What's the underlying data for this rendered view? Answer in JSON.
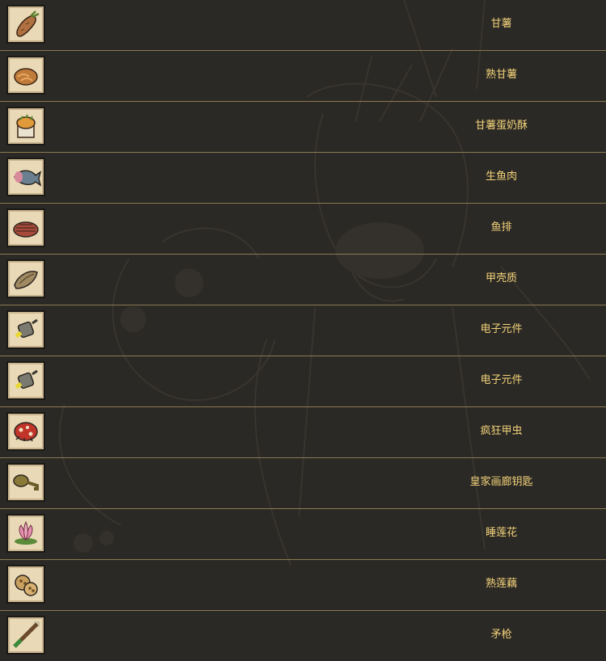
{
  "items": [
    {
      "name": "甘薯",
      "icon": "sweet-potato-icon"
    },
    {
      "name": "熟甘薯",
      "icon": "cooked-sweet-potato-icon"
    },
    {
      "name": "甘薯蛋奶酥",
      "icon": "sweet-potato-souffle-icon"
    },
    {
      "name": "生鱼肉",
      "icon": "raw-fish-icon"
    },
    {
      "name": "鱼排",
      "icon": "fish-steak-icon"
    },
    {
      "name": "甲壳质",
      "icon": "chitin-icon"
    },
    {
      "name": "电子元件",
      "icon": "electrical-doodad-icon"
    },
    {
      "name": "电子元件",
      "icon": "electrical-doodad-icon"
    },
    {
      "name": "疯狂甲虫",
      "icon": "mad-beetle-icon"
    },
    {
      "name": "皇家画廊钥匙",
      "icon": "royal-gallery-key-icon"
    },
    {
      "name": "睡莲花",
      "icon": "lotus-flower-icon"
    },
    {
      "name": "熟莲藕",
      "icon": "cooked-lotus-root-icon"
    },
    {
      "name": "矛枪",
      "icon": "spear-gun-icon"
    }
  ],
  "colors": {
    "background": "#2b2925",
    "divider": "#8c7a52",
    "label": "#f3d27a",
    "icon_frame": "#ead9b6"
  }
}
